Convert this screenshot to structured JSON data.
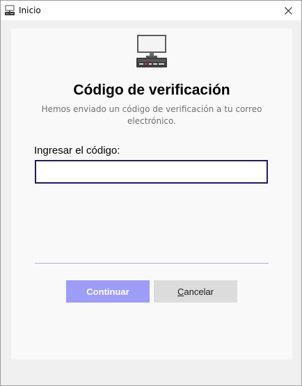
{
  "window": {
    "title": "Inicio"
  },
  "icons": {
    "app": "computer-icon",
    "hero": "computer-icon",
    "close": "close-icon"
  },
  "main": {
    "heading": "Código de verificación",
    "subtitle": "Hemos enviado un código de verificación a tu correo electrónico.",
    "code_label": "Ingresar el código:",
    "code_value": "",
    "code_placeholder": ""
  },
  "buttons": {
    "continue_label": "Continuar",
    "cancel_mnemonic": "C",
    "cancel_rest": "ancelar"
  },
  "colors": {
    "primary_button": "#9d9cf6",
    "secondary_button": "#dcdcdc",
    "input_border": "#1e1b59",
    "divider": "#a9b4d2"
  }
}
